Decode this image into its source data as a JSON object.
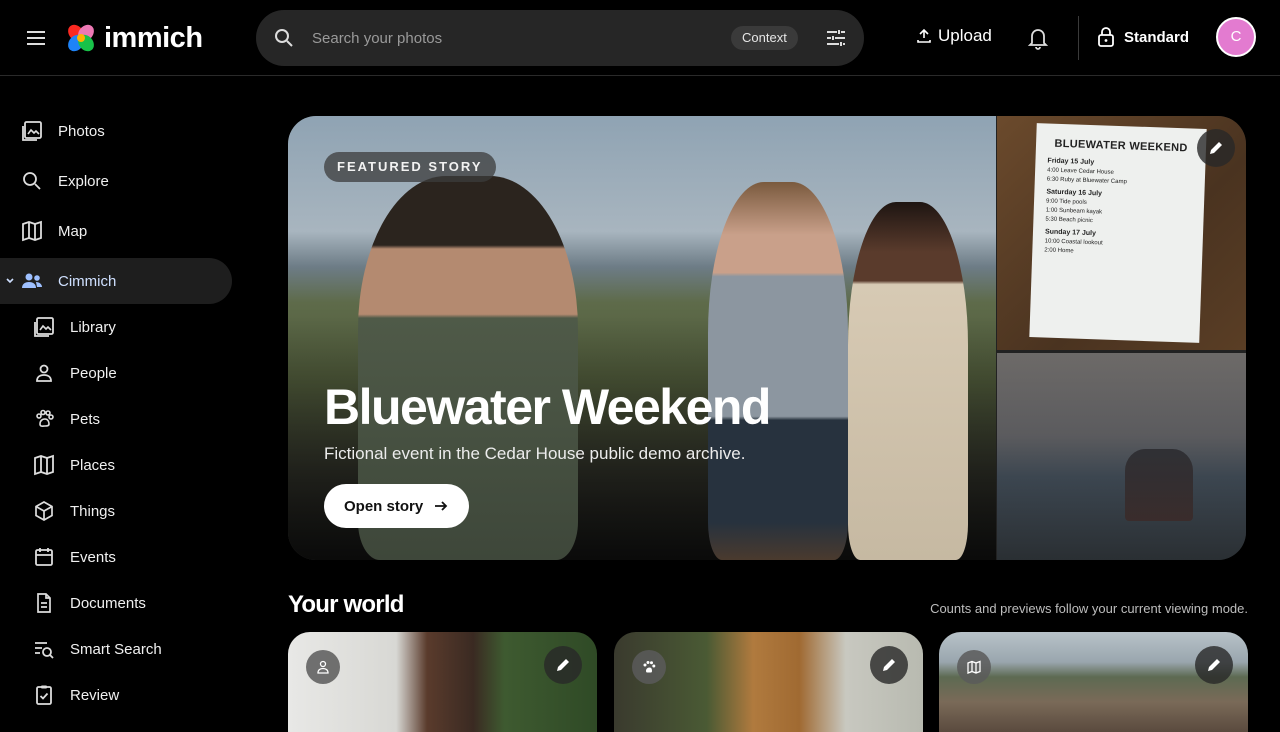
{
  "app": {
    "name": "immich"
  },
  "search": {
    "placeholder": "Search your photos",
    "context_chip": "Context"
  },
  "header": {
    "upload_label": "Upload",
    "mode_label": "Standard",
    "avatar_initial": "C"
  },
  "sidebar": {
    "items": [
      {
        "label": "Photos"
      },
      {
        "label": "Explore"
      },
      {
        "label": "Map"
      },
      {
        "label": "Cimmich"
      }
    ],
    "sub_items": [
      {
        "label": "Library"
      },
      {
        "label": "People"
      },
      {
        "label": "Pets"
      },
      {
        "label": "Places"
      },
      {
        "label": "Things"
      },
      {
        "label": "Events"
      },
      {
        "label": "Documents"
      },
      {
        "label": "Smart Search"
      },
      {
        "label": "Review"
      }
    ]
  },
  "hero": {
    "badge": "FEATURED STORY",
    "title": "Bluewater Weekend",
    "subtitle": "Fictional event in the Cedar House public demo archive.",
    "button_label": "Open story",
    "note_card": {
      "title": "BLUEWATER WEEKEND",
      "days": [
        {
          "day": "Friday 15 July",
          "rows": [
            "4:00   Leave Cedar House",
            "6:30   Ruby at Bluewater Camp"
          ]
        },
        {
          "day": "Saturday 16 July",
          "rows": [
            "9:00   Tide pools",
            "1:00   Sunbeam kayak",
            "5:30   Beach picnic"
          ]
        },
        {
          "day": "Sunday 17 July",
          "rows": [
            "10:00  Coastal lookout",
            "2:00   Home"
          ]
        }
      ]
    }
  },
  "world": {
    "title": "Your world",
    "note": "Counts and previews follow your current viewing mode."
  },
  "colors": {
    "accent_active": "#cfe0ff",
    "avatar": "#e37bd0"
  }
}
